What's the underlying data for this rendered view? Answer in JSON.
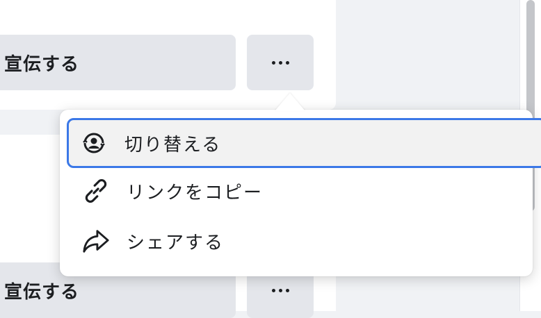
{
  "post_actions": {
    "promote_label": "宣伝する",
    "promote_label_bottom": "宣伝する"
  },
  "menu": {
    "items": [
      {
        "label": "切り替える",
        "icon": "account-switch-icon",
        "selected": true
      },
      {
        "label": "リンクをコピー",
        "icon": "link-icon"
      },
      {
        "label": "シェアする",
        "icon": "share-arrow-icon"
      }
    ]
  },
  "colors": {
    "button_bg": "#e4e6eb",
    "focus_outline": "#3b78e7",
    "page_bg": "#f0f2f5",
    "text": "#1c1e21"
  }
}
